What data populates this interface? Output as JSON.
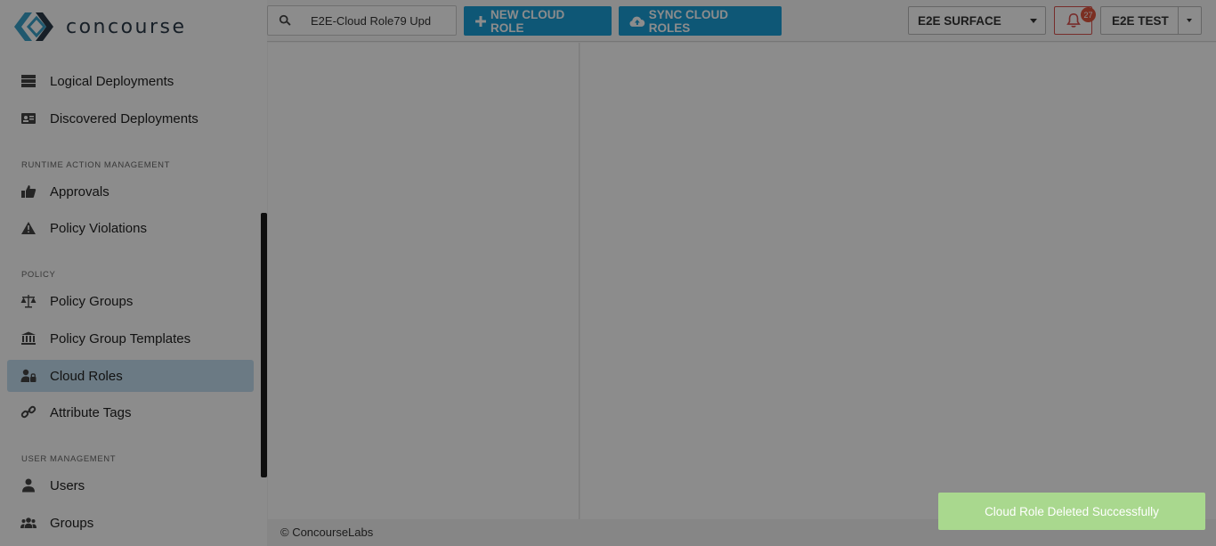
{
  "logo": {
    "text": "concourse"
  },
  "sidebar": {
    "items_top": [
      {
        "label": "Logical Deployments",
        "icon": "server-stack-icon"
      },
      {
        "label": "Discovered Deployments",
        "icon": "id-card-icon"
      }
    ],
    "section_runtime": "RUNTIME ACTION MANAGEMENT",
    "items_runtime": [
      {
        "label": "Approvals",
        "icon": "thumbs-up-icon"
      },
      {
        "label": "Policy Violations",
        "icon": "warning-icon"
      }
    ],
    "section_policy": "POLICY",
    "items_policy": [
      {
        "label": "Policy Groups",
        "icon": "balance-scale-icon"
      },
      {
        "label": "Policy Group Templates",
        "icon": "institution-icon"
      },
      {
        "label": "Cloud Roles",
        "icon": "user-lock-icon",
        "active": true
      },
      {
        "label": "Attribute Tags",
        "icon": "link-icon"
      }
    ],
    "section_users": "USER MANAGEMENT",
    "items_users": [
      {
        "label": "Users",
        "icon": "user-icon"
      },
      {
        "label": "Groups",
        "icon": "users-icon"
      }
    ]
  },
  "topbar": {
    "search_value": "E2E-Cloud Role79 Upd",
    "new_cloud_role": "NEW CLOUD ROLE",
    "sync_cloud_roles": "SYNC CLOUD ROLES",
    "surface_select": "E2E SURFACE",
    "notification_count": "27",
    "user_menu": "E2E TEST"
  },
  "footer": {
    "text": "© ConcourseLabs"
  },
  "toast": {
    "message": "Cloud Role Deleted Successfully"
  },
  "colors": {
    "accent": "#1b9fd8",
    "danger": "#d9534f",
    "toast": "#a9d88e",
    "active_item": "#c4dff0"
  }
}
